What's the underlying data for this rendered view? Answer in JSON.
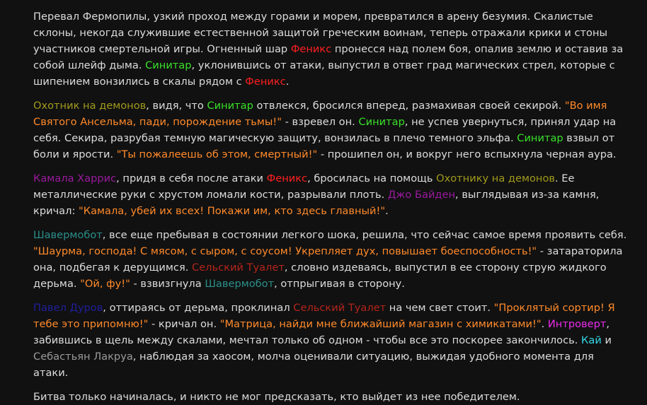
{
  "colors": {
    "background": "#111111",
    "text": "#dcdcdc",
    "quote": "#ff8a2b",
    "feniks": "#ff1f1f",
    "sinitar": "#39e02a",
    "hunter": "#a19a1c",
    "kamala_biden": "#9a1a9f",
    "shavermobot": "#2a8f8a",
    "toilet": "#b3241b",
    "durov": "#1f1f9c",
    "introvert": "#ea2bea",
    "kai": "#33d8e6",
    "lacroix": "#9a9a9a"
  },
  "story": [
    {
      "segments": [
        {
          "s": "t",
          "v": "Перевал Фермопилы, узкий проход между горами и морем, превратился в арену безумия. Скалистые склоны, некогда служившие естественной защитой греческим воинам, теперь отражали крики и стоны участников смертельной игры. Огненный шар "
        },
        {
          "s": "n-red",
          "v": "Феникс"
        },
        {
          "s": "t",
          "v": " пронесся над полем боя, опалив землю и оставив за собой шлейф дыма. "
        },
        {
          "s": "n-green",
          "v": "Синитар"
        },
        {
          "s": "t",
          "v": ", уклонившись от атаки, выпустил в ответ град магических стрел, которые с шипением вонзились в скалы рядом с "
        },
        {
          "s": "n-red",
          "v": "Феникс"
        },
        {
          "s": "t",
          "v": "."
        }
      ]
    },
    {
      "segments": [
        {
          "s": "n-olive",
          "v": "Охотник на демонов"
        },
        {
          "s": "t",
          "v": ", видя, что "
        },
        {
          "s": "n-green",
          "v": "Синитар"
        },
        {
          "s": "t",
          "v": " отвлекся, бросился вперед, размахивая своей секирой. "
        },
        {
          "s": "q",
          "v": "\"Во имя Святого Ансельма, пади, порождение тьмы!\""
        },
        {
          "s": "t",
          "v": " - взревел он. "
        },
        {
          "s": "n-green",
          "v": "Синитар"
        },
        {
          "s": "t",
          "v": ", не успев увернуться, принял удар на себя. Секира, разрубая темную магическую защиту, вонзилась в плечо темного эльфа. "
        },
        {
          "s": "n-green",
          "v": "Синитар"
        },
        {
          "s": "t",
          "v": " взвыл от боли и ярости. "
        },
        {
          "s": "q",
          "v": "\"Ты пожалеешь об этом, смертный!\""
        },
        {
          "s": "t",
          "v": " - прошипел он, и вокруг него вспыхнула черная аура."
        }
      ]
    },
    {
      "segments": [
        {
          "s": "n-purple",
          "v": "Камала Харрис"
        },
        {
          "s": "t",
          "v": ", придя в себя после атаки "
        },
        {
          "s": "n-red",
          "v": "Феникс"
        },
        {
          "s": "t",
          "v": ", бросилась на помощь "
        },
        {
          "s": "n-olive",
          "v": "Охотнику на демонов"
        },
        {
          "s": "t",
          "v": ". Ее металлические руки с хрустом ломали кости, разрывали плоть. "
        },
        {
          "s": "n-purple",
          "v": "Джо Байден"
        },
        {
          "s": "t",
          "v": ", выглядывая из-за камня, кричал: "
        },
        {
          "s": "q",
          "v": "\"Камала, убей их всех! Покажи им, кто здесь главный!\""
        },
        {
          "s": "t",
          "v": "."
        }
      ]
    },
    {
      "segments": [
        {
          "s": "n-teal",
          "v": "Шавермобот"
        },
        {
          "s": "t",
          "v": ", все еще пребывая в состоянии легкого шока, решила, что сейчас самое время проявить себя. "
        },
        {
          "s": "q",
          "v": "\"Шаурма, господа! С мясом, с сыром, с соусом! Укрепляет дух, повышает боеспособность!\""
        },
        {
          "s": "t",
          "v": " - затараторила она, подбегая к дерущимся. "
        },
        {
          "s": "n-darkred",
          "v": "Сельский Туалет"
        },
        {
          "s": "t",
          "v": ", словно издеваясь, выпустил в ее сторону струю жидкого дерьма. "
        },
        {
          "s": "q",
          "v": "\"Ой, фу!\""
        },
        {
          "s": "t",
          "v": " - взвизгнула "
        },
        {
          "s": "n-teal",
          "v": "Шавермобот"
        },
        {
          "s": "t",
          "v": ", отпрыгивая в сторону."
        }
      ]
    },
    {
      "segments": [
        {
          "s": "n-navy",
          "v": "Павел Дуров"
        },
        {
          "s": "t",
          "v": ", оттираясь от дерьма, проклинал "
        },
        {
          "s": "n-darkred",
          "v": "Сельский Туалет"
        },
        {
          "s": "t",
          "v": " на чем свет стоит. "
        },
        {
          "s": "q",
          "v": "\"Проклятый сортир! Я тебе это припомню!\""
        },
        {
          "s": "t",
          "v": " - кричал он. "
        },
        {
          "s": "q",
          "v": "\"Матрица, найди мне ближайший магазин с химикатами!\""
        },
        {
          "s": "t",
          "v": ". "
        },
        {
          "s": "n-magenta",
          "v": "Интроверт"
        },
        {
          "s": "t",
          "v": ", забившись в щель между скалами, мечтал только об одном - чтобы все это поскорее закончилось. "
        },
        {
          "s": "n-cyan",
          "v": "Кай"
        },
        {
          "s": "t",
          "v": " и "
        },
        {
          "s": "n-gray",
          "v": "Себастьян Лакруа"
        },
        {
          "s": "t",
          "v": ", наблюдая за хаосом, молча оценивали ситуацию, выжидая удобного момента для атаки."
        }
      ]
    },
    {
      "segments": [
        {
          "s": "t",
          "v": "Битва только начиналась, и никто не мог предсказать, кто выйдет из нее победителем."
        }
      ]
    }
  ]
}
